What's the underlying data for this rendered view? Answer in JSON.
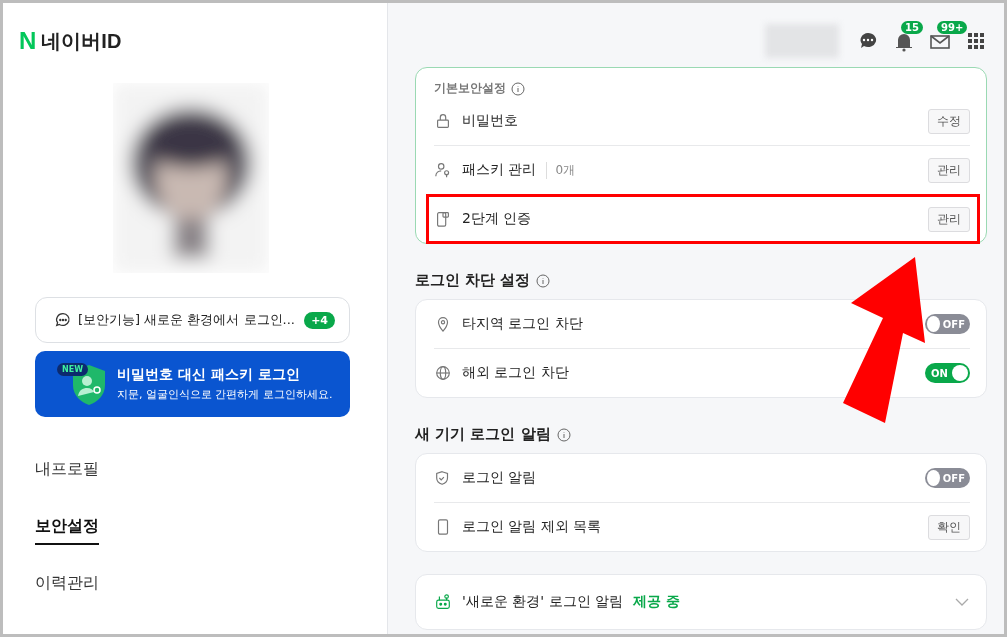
{
  "logo": {
    "mark": "N",
    "text": "네이버ID"
  },
  "notice": {
    "text": "[보안기능] 새로운 환경에서 로그인...",
    "badge": "+4"
  },
  "banner": {
    "badge": "NEW",
    "title": "비밀번호 대신 **패스키 로그인**",
    "subtitle": "지문, 얼굴인식으로 간편하게 로그인하세요."
  },
  "nav": [
    {
      "label": "내프로필",
      "selected": false
    },
    {
      "label": "보안설정",
      "selected": true
    },
    {
      "label": "이력관리",
      "selected": false
    }
  ],
  "header": {
    "notifications": "15",
    "mail": "99+"
  },
  "sections": [
    {
      "title": "기본보안설정",
      "rows": [
        {
          "kind": "button",
          "label": "비밀번호",
          "action": "수정",
          "highlighted": false
        },
        {
          "kind": "button",
          "label": "패스키 관리",
          "count": "0개",
          "action": "관리",
          "highlighted": false
        },
        {
          "kind": "button",
          "label": "2단계 인증",
          "action": "관리",
          "highlighted": true
        }
      ]
    },
    {
      "title": "로그인 차단 설정",
      "rows": [
        {
          "kind": "toggle",
          "label": "타지역 로그인 차단",
          "on": false,
          "state": "OFF",
          "highlighted": false
        },
        {
          "kind": "toggle",
          "label": "해외 로그인 차단",
          "on": true,
          "state": "ON",
          "highlighted": false
        }
      ]
    },
    {
      "title": "새 기기 로그인 알림",
      "rows": [
        {
          "kind": "toggle",
          "label": "로그인 알림",
          "on": false,
          "state": "OFF",
          "highlighted": false
        },
        {
          "kind": "button",
          "label": "로그인 알림 제외 목록",
          "action": "확인",
          "highlighted": false
        }
      ]
    }
  ],
  "footer_card": {
    "label": "'새로운 환경' 로그인 알림",
    "status": "제공 중",
    "expanded": false
  }
}
